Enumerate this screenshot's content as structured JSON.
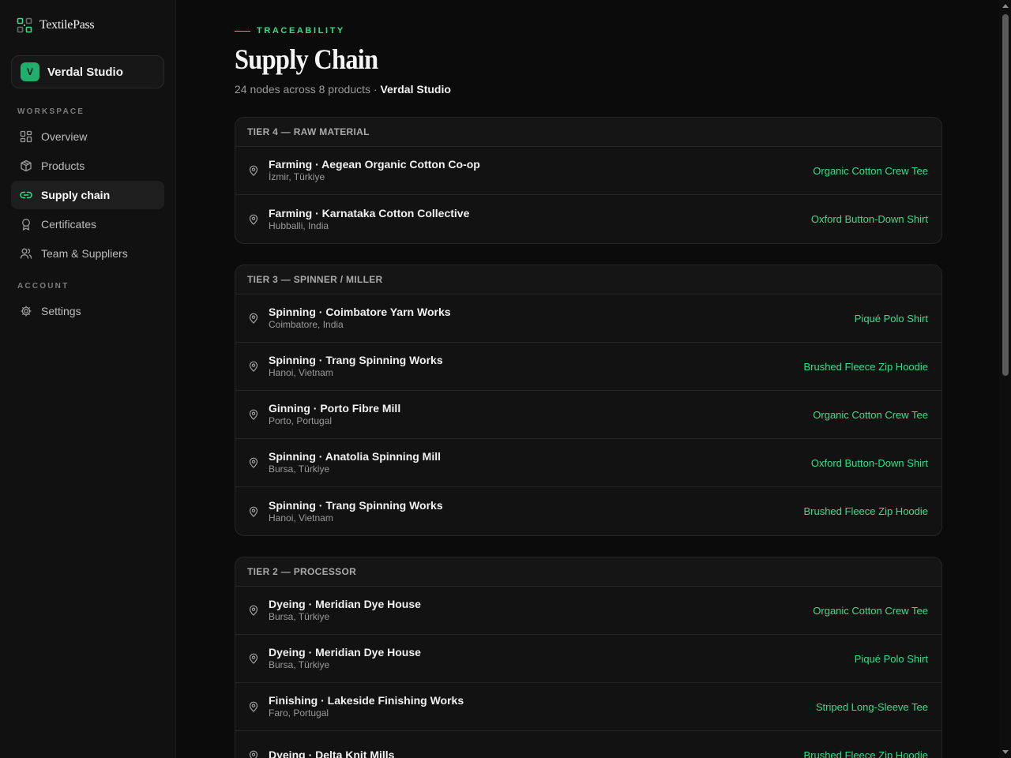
{
  "brand": {
    "name": "TextilePass",
    "icon": "qr-logo-icon"
  },
  "org": {
    "initial": "V",
    "name": "Verdal Studio"
  },
  "sidebar": {
    "workspace_label": "WORKSPACE",
    "workspace_items": [
      {
        "label": "Overview",
        "icon": "grid-icon",
        "active": false
      },
      {
        "label": "Products",
        "icon": "box-icon",
        "active": false
      },
      {
        "label": "Supply chain",
        "icon": "link-icon",
        "active": true
      },
      {
        "label": "Certificates",
        "icon": "award-icon",
        "active": false
      },
      {
        "label": "Team & Suppliers",
        "icon": "users-icon",
        "active": false
      }
    ],
    "account_label": "ACCOUNT",
    "account_items": [
      {
        "label": "Settings",
        "icon": "gear-icon",
        "active": false
      }
    ]
  },
  "header": {
    "eyebrow": "TRACEABILITY",
    "title": "Supply Chain",
    "subtitle_prefix": "24 nodes across 8 products · ",
    "subtitle_org": "Verdal Studio"
  },
  "tiers": [
    {
      "label": "TIER 4 — RAW MATERIAL",
      "nodes": [
        {
          "title": "Farming · Aegean Organic Cotton Co-op",
          "location": "İzmir, Türkiye",
          "product": "Organic Cotton Crew Tee"
        },
        {
          "title": "Farming · Karnataka Cotton Collective",
          "location": "Hubballi, India",
          "product": "Oxford Button-Down Shirt"
        }
      ]
    },
    {
      "label": "TIER 3 — SPINNER / MILLER",
      "nodes": [
        {
          "title": "Spinning · Coimbatore Yarn Works",
          "location": "Coimbatore, India",
          "product": "Piqué Polo Shirt"
        },
        {
          "title": "Spinning · Trang Spinning Works",
          "location": "Hanoi, Vietnam",
          "product": "Brushed Fleece Zip Hoodie"
        },
        {
          "title": "Ginning · Porto Fibre Mill",
          "location": "Porto, Portugal",
          "product": "Organic Cotton Crew Tee"
        },
        {
          "title": "Spinning · Anatolia Spinning Mill",
          "location": "Bursa, Türkiye",
          "product": "Oxford Button-Down Shirt"
        },
        {
          "title": "Spinning · Trang Spinning Works",
          "location": "Hanoi, Vietnam",
          "product": "Brushed Fleece Zip Hoodie"
        }
      ]
    },
    {
      "label": "TIER 2 — PROCESSOR",
      "nodes": [
        {
          "title": "Dyeing · Meridian Dye House",
          "location": "Bursa, Türkiye",
          "product": "Organic Cotton Crew Tee"
        },
        {
          "title": "Dyeing · Meridian Dye House",
          "location": "Bursa, Türkiye",
          "product": "Piqué Polo Shirt"
        },
        {
          "title": "Finishing · Lakeside Finishing Works",
          "location": "Faro, Portugal",
          "product": "Striped Long-Sleeve Tee"
        },
        {
          "title": "Dyeing · Delta Knit Mills",
          "location": "",
          "product": "Brushed Fleece Zip Hoodie"
        }
      ]
    }
  ],
  "colors": {
    "accent": "#2ee08c",
    "background": "#0b0b0b",
    "sidebar": "#111111",
    "avatar": "#1fae6c"
  }
}
